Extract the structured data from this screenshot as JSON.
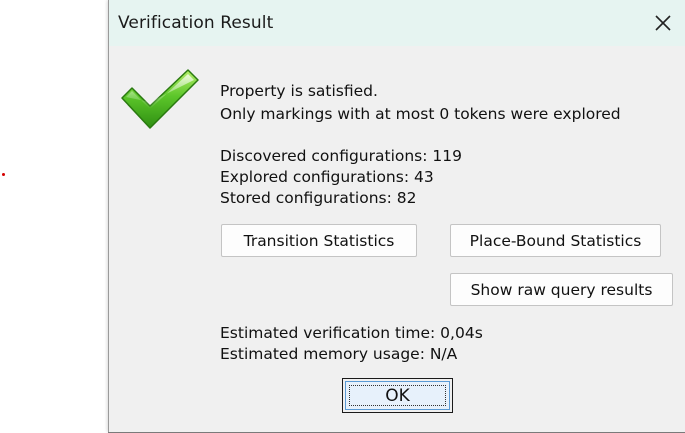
{
  "dialog": {
    "title": "Verification Result",
    "close_icon": "close-icon",
    "status_icon": "checkmark-icon"
  },
  "result": {
    "status": "Property is satisfied.",
    "note": "Only markings with at most 0 tokens were explored"
  },
  "statistics": {
    "discovered": "Discovered configurations: 119",
    "explored": "Explored configurations: 43",
    "stored": "Stored configurations: 82"
  },
  "buttons": {
    "transition_statistics": "Transition Statistics",
    "place_bound_statistics": "Place-Bound Statistics",
    "raw_query_results": "Show raw query results",
    "ok": "OK"
  },
  "estimates": {
    "time": "Estimated verification time: 0,04s",
    "memory": "Estimated memory usage: N/A"
  },
  "colors": {
    "titlebar": "#e6f4f1",
    "dialog_bg": "#f0f0f0",
    "check_green": "#4caf2a",
    "ok_focus": "#5b9bd5"
  }
}
